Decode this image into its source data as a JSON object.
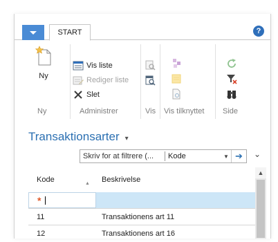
{
  "tabs": {
    "active": "START"
  },
  "help": {
    "glyph": "?"
  },
  "ribbon": {
    "ny_group": {
      "new_label": "Ny",
      "group_label": "Ny"
    },
    "administrer": {
      "view_list": "Vis liste",
      "edit_list": "Rediger liste",
      "delete": "Slet",
      "group_label": "Administrer"
    },
    "vis": {
      "group_label": "Vis"
    },
    "vis_tilknyttet": {
      "group_label": "Vis tilknyttet"
    },
    "side": {
      "group_label": "Side"
    }
  },
  "page": {
    "title": "Transaktionsarter",
    "title_caret": "▾"
  },
  "filter": {
    "placeholder": "Skriv for at filtrere (...",
    "field": "Kode",
    "dropdown_glyph": "▼",
    "go_glyph": "➔"
  },
  "collapse": {
    "glyph": "⌄"
  },
  "grid": {
    "columns": {
      "kode": "Kode",
      "beskrivelse": "Beskrivelse",
      "sort_glyph": "▲"
    },
    "new_row_marker": "*",
    "rows": [
      {
        "kode": "11",
        "beskrivelse": "Transaktionens art 11"
      },
      {
        "kode": "12",
        "beskrivelse": "Transaktionens art 16"
      }
    ]
  },
  "scroll": {
    "up_glyph": "▲"
  },
  "colors": {
    "accent": "#2c70b2",
    "app_button": "#4a8bd5",
    "new_row": "#cde6f7",
    "star": "#e05a2b"
  }
}
